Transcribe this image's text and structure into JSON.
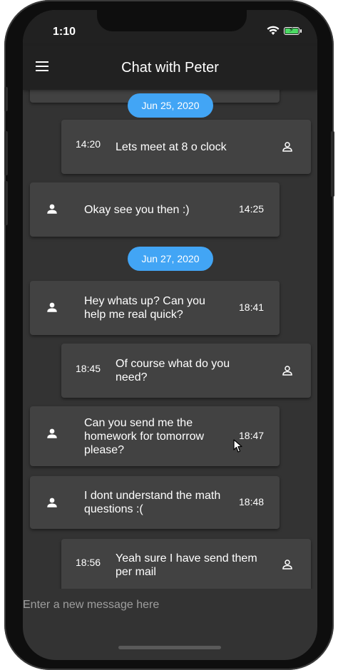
{
  "status_bar": {
    "time": "1:10"
  },
  "app_bar": {
    "title": "Chat with Peter",
    "menu_icon": "menu-icon"
  },
  "messages": [
    {
      "text": "",
      "time": "",
      "sender": "peter"
    },
    {
      "type": "date",
      "label": "Jun 25, 2020"
    },
    {
      "text": "Lets meet at 8 o clock",
      "time": "14:20",
      "sender": "me"
    },
    {
      "text": "Okay see you then :)",
      "time": "14:25",
      "sender": "peter"
    },
    {
      "type": "date",
      "label": "Jun 27, 2020"
    },
    {
      "text": "Hey whats up? Can you help me real quick?",
      "time": "18:41",
      "sender": "peter"
    },
    {
      "text": "Of course  what do you need?",
      "time": "18:45",
      "sender": "me"
    },
    {
      "text": "Can you send me the homework for tomorrow please?",
      "time": "18:47",
      "sender": "peter"
    },
    {
      "text": "I dont understand the math questions :(",
      "time": "18:48",
      "sender": "peter"
    },
    {
      "text": "Yeah sure I have send them per mail",
      "time": "18:56",
      "sender": "me"
    }
  ],
  "input": {
    "placeholder": "Enter a new message here",
    "value": ""
  },
  "colors": {
    "background": "#333333",
    "app_bar": "#212121",
    "card": "#424242",
    "date_chip": "#42a5f5"
  }
}
